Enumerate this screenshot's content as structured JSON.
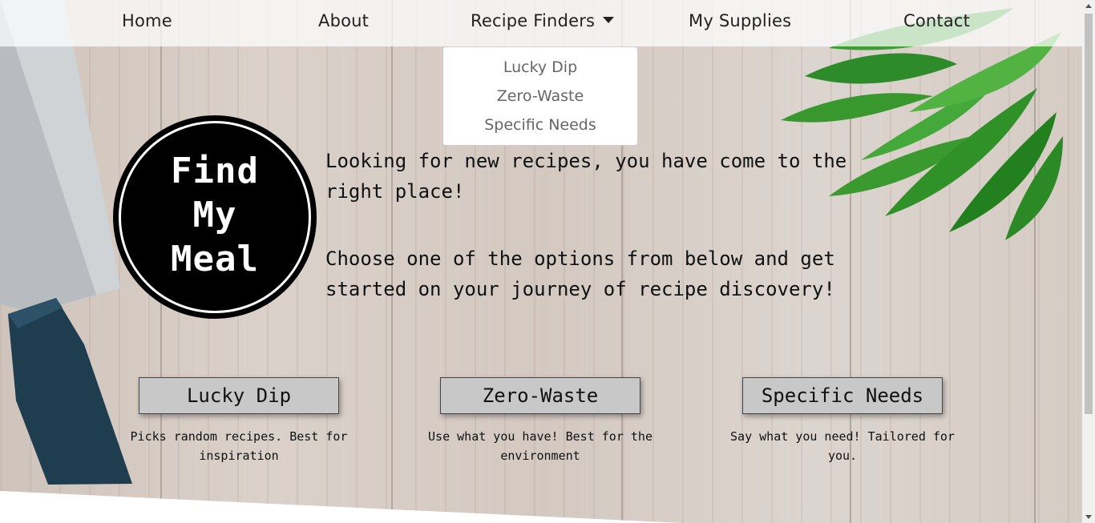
{
  "nav": {
    "items": [
      {
        "label": "Home"
      },
      {
        "label": "About"
      },
      {
        "label": "Recipe Finders"
      },
      {
        "label": "My Supplies"
      },
      {
        "label": "Contact"
      }
    ]
  },
  "dropdown": {
    "items": [
      "Lucky Dip",
      "Zero-Waste",
      "Specific Needs"
    ]
  },
  "logo": {
    "line1": "Find",
    "line2": "My",
    "line3": "Meal"
  },
  "intro": {
    "para1": "Looking for new recipes, you have come to the right place!",
    "para2": "Choose one of the options from below and get started on your journey of recipe discovery!"
  },
  "options": [
    {
      "label": "Lucky Dip",
      "description": "Picks random recipes. Best for inspiration"
    },
    {
      "label": "Zero-Waste",
      "description": "Use what you have! Best for the environment"
    },
    {
      "label": "Specific Needs",
      "description": "Say what you need! Tailored for you."
    }
  ],
  "colors": {
    "button_bg": "#c8c8c8",
    "logo_bg": "#000000",
    "navbar_bg": "rgba(255,255,255,0.72)"
  },
  "icons": {
    "dropdown": "caret-down-icon"
  }
}
